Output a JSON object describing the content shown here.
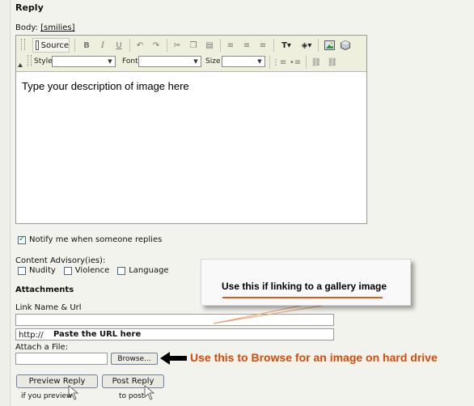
{
  "page": {
    "title": "Reply"
  },
  "body_label": {
    "text": "Body:",
    "smilies_link": "[smilies]"
  },
  "toolbar": {
    "source_label": "Source",
    "bold": "B",
    "italic": "I",
    "underline": "U",
    "style_label": "Style",
    "font_label": "Font",
    "size_label": "Size"
  },
  "editor": {
    "content": "Type your description of image here"
  },
  "notify": {
    "label": "Notify me when someone replies",
    "checked": true
  },
  "advisory": {
    "label": "Content Advisory(ies):",
    "options": [
      {
        "label": "Nudity",
        "checked": false
      },
      {
        "label": "Violence",
        "checked": false
      },
      {
        "label": "Language",
        "checked": false
      }
    ]
  },
  "attachments": {
    "heading": "Attachments",
    "link_label": "Link Name & Url",
    "url_prefix": "http://",
    "url_annotation": "Paste the URL here",
    "file_label": "Attach a File:",
    "browse_button": "Browse...",
    "browse_annotation": "Use this to Browse for an image on  hard drive"
  },
  "callout": {
    "text": "Use this if linking to a gallery image"
  },
  "buttons": {
    "preview": "Preview Reply",
    "post": "Post Reply",
    "preview_caption": "if you preview",
    "post_caption": "to post"
  },
  "colors": {
    "annotation_orange": "#d84a06",
    "callout_line": "#e25a14",
    "check_green": "#2a8a2a"
  }
}
